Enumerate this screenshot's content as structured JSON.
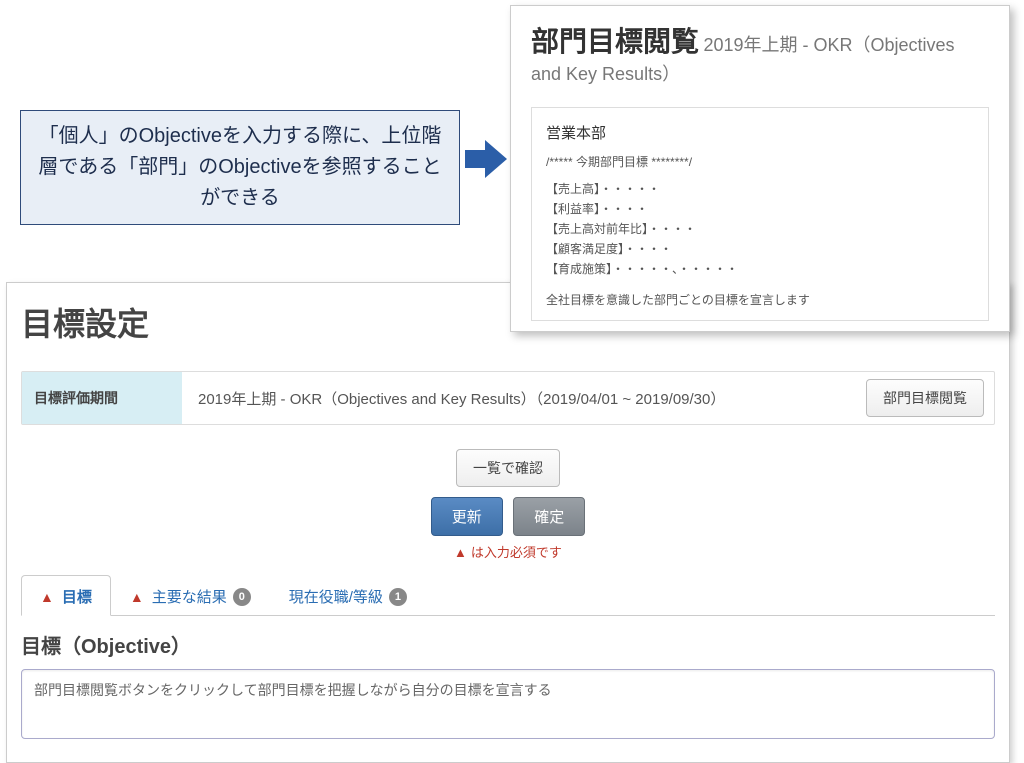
{
  "popup": {
    "title": "部門目標閲覧",
    "subtitle": "2019年上期 - OKR（Objectives and Key Results）",
    "department": "営業本部",
    "separator": "/***** 今期部門目標 ********/",
    "lines": [
      "【売上高】・・・・・",
      "【利益率】・・・・",
      "【売上高対前年比】・・・・",
      "【顧客満足度】・・・・",
      "【育成施策】・・・・・、・・・・・"
    ],
    "footer": "全社目標を意識した部門ごとの目標を宣言します"
  },
  "callout": {
    "text": "「個人」のObjectiveを入力する際に、上位階層である「部門」のObjectiveを参照することができる"
  },
  "main": {
    "page_title": "目標設定",
    "period_label": "目標評価期間",
    "period_value": "2019年上期 - OKR（Objectives and Key Results）（2019/04/01 ~ 2019/09/30）",
    "view_dept_btn": "部門目標閲覧",
    "list_confirm_btn": "一覧で確認",
    "update_btn": "更新",
    "confirm_btn": "確定",
    "required_note": "は入力必須です",
    "tabs": {
      "objective": "目標",
      "key_results": "主要な結果",
      "key_results_badge": "0",
      "position": "現在役職/等級",
      "position_badge": "1"
    },
    "section_title": "目標（Objective）",
    "objective_value": "部門目標閲覧ボタンをクリックして部門目標を把握しながら自分の目標を宣言する"
  }
}
